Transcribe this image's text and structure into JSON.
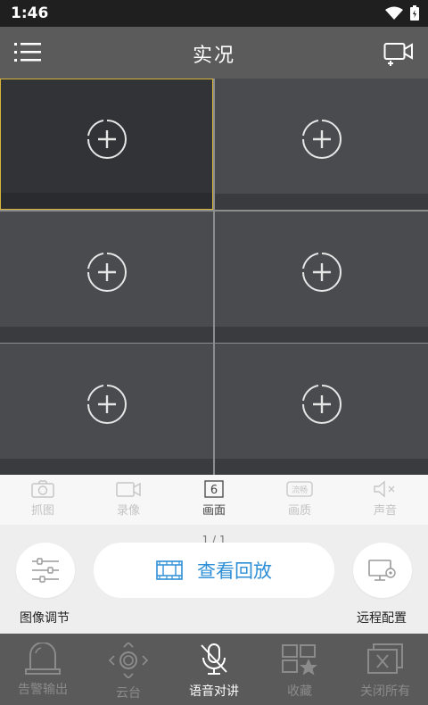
{
  "status_bar": {
    "time": "1:46"
  },
  "header": {
    "title": "实况"
  },
  "grid": {
    "cells": 6
  },
  "toolbar": {
    "items": [
      {
        "label": "抓图",
        "icon": "camera-icon"
      },
      {
        "label": "录像",
        "icon": "video-record-icon"
      },
      {
        "label": "画面",
        "icon": "layout-6-icon",
        "badge": "6"
      },
      {
        "label": "画质",
        "icon": "quality-icon",
        "badge": "流畅"
      },
      {
        "label": "声音",
        "icon": "mute-icon"
      }
    ]
  },
  "controls": {
    "page_indicator": "1 / 1",
    "image_adjust_label": "图像调节",
    "playback_label": "查看回放",
    "remote_config_label": "远程配置"
  },
  "bottom_nav": {
    "items": [
      {
        "label": "告警输出",
        "icon": "alarm-icon"
      },
      {
        "label": "云台",
        "icon": "ptz-icon"
      },
      {
        "label": "语音对讲",
        "icon": "mic-off-icon"
      },
      {
        "label": "收藏",
        "icon": "favorite-icon"
      },
      {
        "label": "关闭所有",
        "icon": "close-all-icon"
      }
    ]
  },
  "colors": {
    "accent": "#2e8fd7",
    "selected_border": "#d6b33a",
    "cell_bg": "#4a4b4f"
  }
}
